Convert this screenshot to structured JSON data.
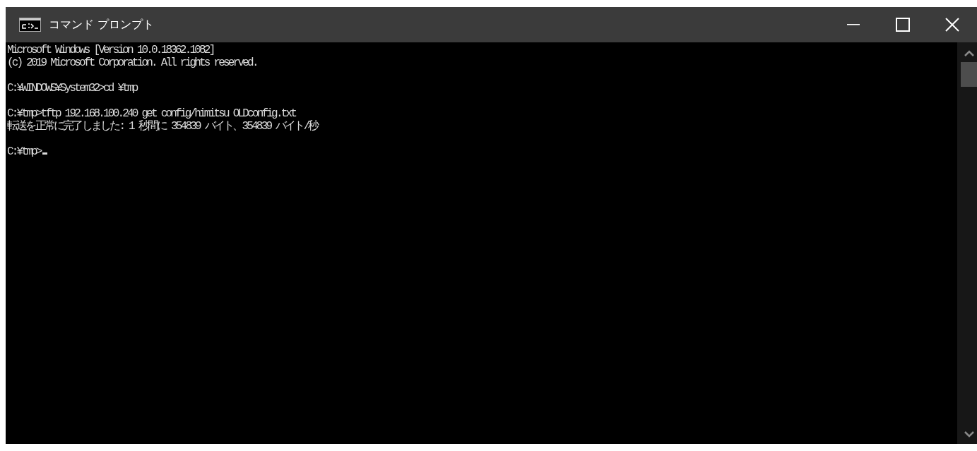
{
  "window": {
    "title": "コマンド プロンプト"
  },
  "console": {
    "blocks": [
      [
        "Microsoft Windows [Version 10.0.18362.1082]",
        "(c) 2019 Microsoft Corporation. All rights reserved."
      ],
      [
        "C:¥WINDOWS¥System32>cd ¥tmp"
      ],
      [
        "C:¥tmp>tftp 192.168.100.240 get config/himitsu OLDconfig.txt",
        "転送を正常に完了しました: 1 秒間に 354839 バイト、354839 バイト/秒"
      ],
      [
        "C:¥tmp>"
      ]
    ]
  }
}
